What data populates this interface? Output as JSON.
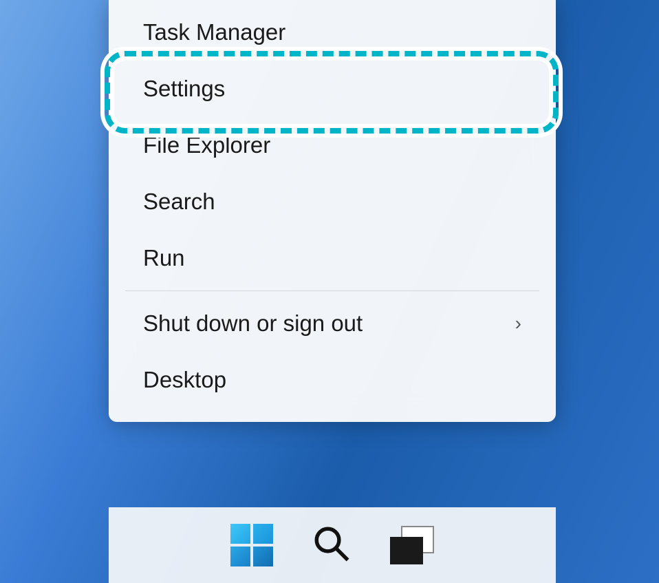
{
  "contextMenu": {
    "items": [
      {
        "label": "Task Manager",
        "hasSubmenu": false
      },
      {
        "label": "Settings",
        "hasSubmenu": false,
        "highlighted": true
      },
      {
        "label": "File Explorer",
        "hasSubmenu": false
      },
      {
        "label": "Search",
        "hasSubmenu": false
      },
      {
        "label": "Run",
        "hasSubmenu": false
      }
    ],
    "itemsAfterDivider": [
      {
        "label": "Shut down or sign out",
        "hasSubmenu": true
      },
      {
        "label": "Desktop",
        "hasSubmenu": false
      }
    ],
    "submenuArrow": "›"
  },
  "taskbar": {
    "icons": {
      "start": "start-icon",
      "search": "search-icon",
      "taskview": "taskview-icon"
    }
  }
}
